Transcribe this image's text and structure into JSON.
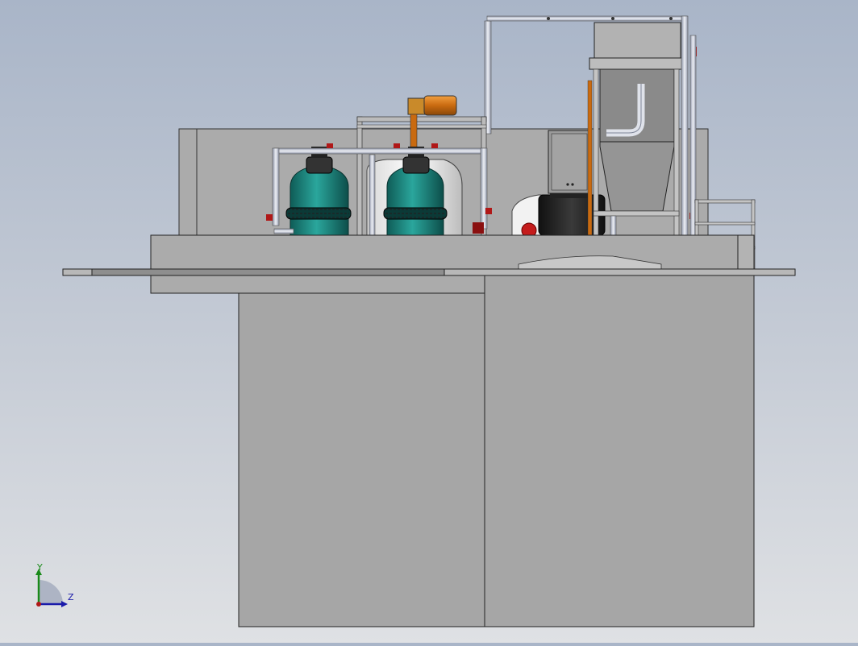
{
  "scene": {
    "background_top": "#a9b5c8",
    "background_bottom": "#dfe1e4",
    "body_color": "#a6a6a6",
    "panel_color": "#b5b5b5",
    "tank_color": "#1c7f78",
    "motor_color": "#d97a1a",
    "valve_color": "#b01818",
    "pipe_color": "#cfd4e0"
  },
  "triad": {
    "y_label": "Y",
    "z_label": "Z",
    "y_color": "#1a8a1a",
    "z_color": "#1a1aaa"
  }
}
